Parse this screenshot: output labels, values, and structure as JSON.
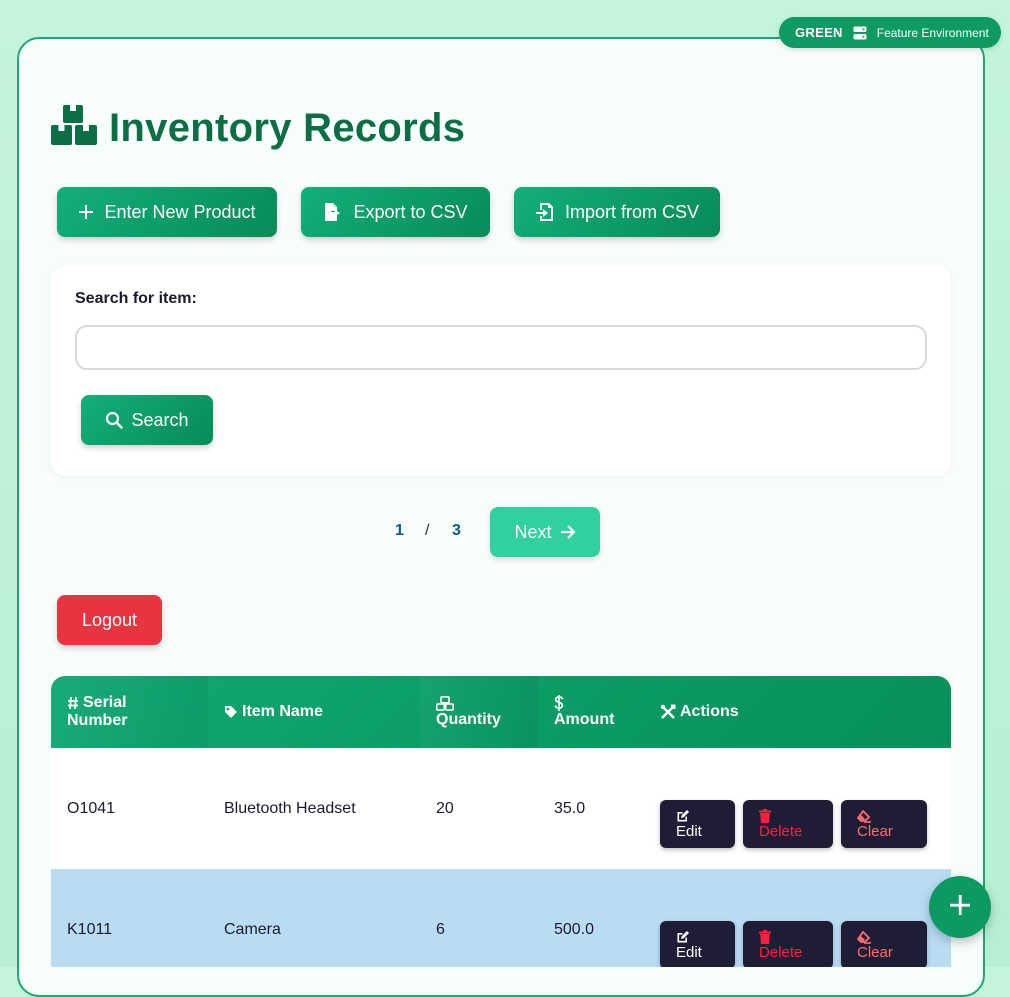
{
  "environment": {
    "name": "GREEN",
    "description": "Feature Environment"
  },
  "page": {
    "title": "Inventory Records"
  },
  "toolbar": {
    "new_product_label": "Enter New Product",
    "export_label": "Export to CSV",
    "import_label": "Import from CSV"
  },
  "search": {
    "label": "Search for item:",
    "value": "",
    "placeholder": "",
    "button_label": "Search"
  },
  "pagination": {
    "current": "1",
    "separator": "/",
    "total": "3",
    "next_label": "Next"
  },
  "logout_label": "Logout",
  "table": {
    "columns": {
      "serial": {
        "line1": "Serial",
        "line2": "Number"
      },
      "name": "Item Name",
      "quantity": "Quantity",
      "amount": "Amount",
      "actions": "Actions"
    },
    "rows": [
      {
        "serial": "O1041",
        "name": "Bluetooth Headset",
        "quantity": "20",
        "amount": "35.0",
        "background": "#ffffff"
      },
      {
        "serial": "K1011",
        "name": "Camera",
        "quantity": "6",
        "amount": "500.0",
        "background": "#b8dcf4"
      }
    ],
    "action_labels": {
      "edit": "Edit",
      "delete": "Delete",
      "clear": "Clear"
    }
  },
  "colors": {
    "accent_green": "#0f9a63",
    "title_green": "#0b6e45",
    "next_button": "#2fd19e",
    "logout_red": "#e8343e",
    "action_dark": "#1f1d35",
    "delete_red": "#ff1f3d",
    "clear_red": "#ff6b6b",
    "row_highlight": "#b8dcf4"
  }
}
